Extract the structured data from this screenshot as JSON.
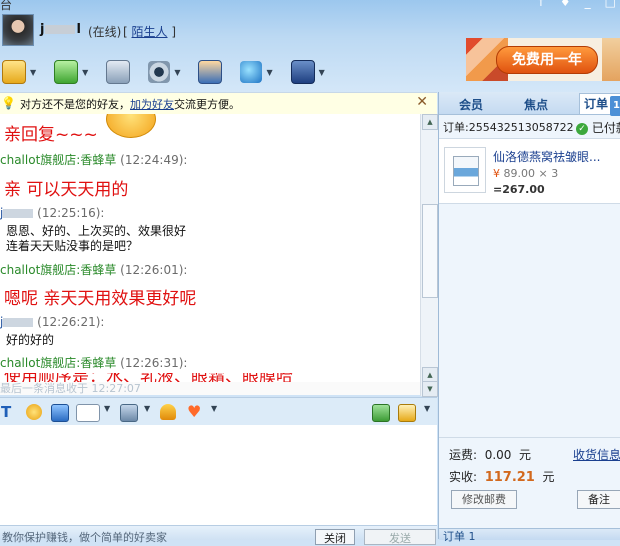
{
  "window": {
    "corner_char": "台",
    "controls": [
      "↑",
      "♦",
      "_",
      "□"
    ]
  },
  "contact": {
    "name_prefix": "j",
    "name_suffix": "l",
    "status": "(在线)",
    "stranger_bracket_open": "[",
    "stranger_label": "陌生人",
    "stranger_bracket_close": "]"
  },
  "ad": {
    "label": "免费用一年"
  },
  "notice": {
    "text_before": "对方还不是您的好友，",
    "link": "加为好友",
    "text_after": "交流更方便。",
    "close": "✕"
  },
  "messages": [
    {
      "type": "big",
      "text": "亲回复~~~"
    },
    {
      "type": "head",
      "sender": "challot旗舰店:香蜂草",
      "time": "(12:24:49):"
    },
    {
      "type": "big",
      "text": "亲 可以天天用的"
    },
    {
      "type": "head",
      "sender_masked": "j",
      "time": "(12:25:16):"
    },
    {
      "type": "small",
      "lines": [
        "恩恩、好的、上次买的、效果很好",
        "连着天天贴没事的是吧？"
      ]
    },
    {
      "type": "head",
      "sender": "challot旗舰店:香蜂草",
      "time": "(12:26:01):"
    },
    {
      "type": "big",
      "text": "嗯呢 亲天天用效果更好呢"
    },
    {
      "type": "head",
      "sender_masked": "j",
      "time": "(12:26:21):"
    },
    {
      "type": "small",
      "lines": [
        "好的好的"
      ]
    },
    {
      "type": "head",
      "sender": "challot旗舰店:香蜂草",
      "time": "(12:26:31):"
    },
    {
      "type": "big_partial",
      "text": "使用顺序是：水、乳液、眼霜、眼膜哈"
    }
  ],
  "last_message_time": "最后一条消息收于 12:27:07",
  "bottom": {
    "link_text": "教你保护赚钱，做个简单的好卖家",
    "close_label": "关闭",
    "send_label": "发送"
  },
  "right_panel": {
    "tabs": {
      "member": "会员",
      "focus": "焦点",
      "order": "订单",
      "order_badge": "1"
    },
    "order_number": "订单:255432513058722",
    "order_status": "已付款",
    "product": {
      "title": "仙洛德燕窝祛皱眼...",
      "price": "89.00",
      "qty": "× 3",
      "total": "=267.00"
    },
    "shipping_label": "运费:",
    "shipping_value": "0.00",
    "shipping_unit": "元",
    "shipping_info_link": "收货信息",
    "paid_label": "实收:",
    "paid_value": "117.21",
    "paid_unit": "元",
    "edit_postage": "修改邮费",
    "remark": "备注",
    "bottom_tab": "订单 1"
  }
}
